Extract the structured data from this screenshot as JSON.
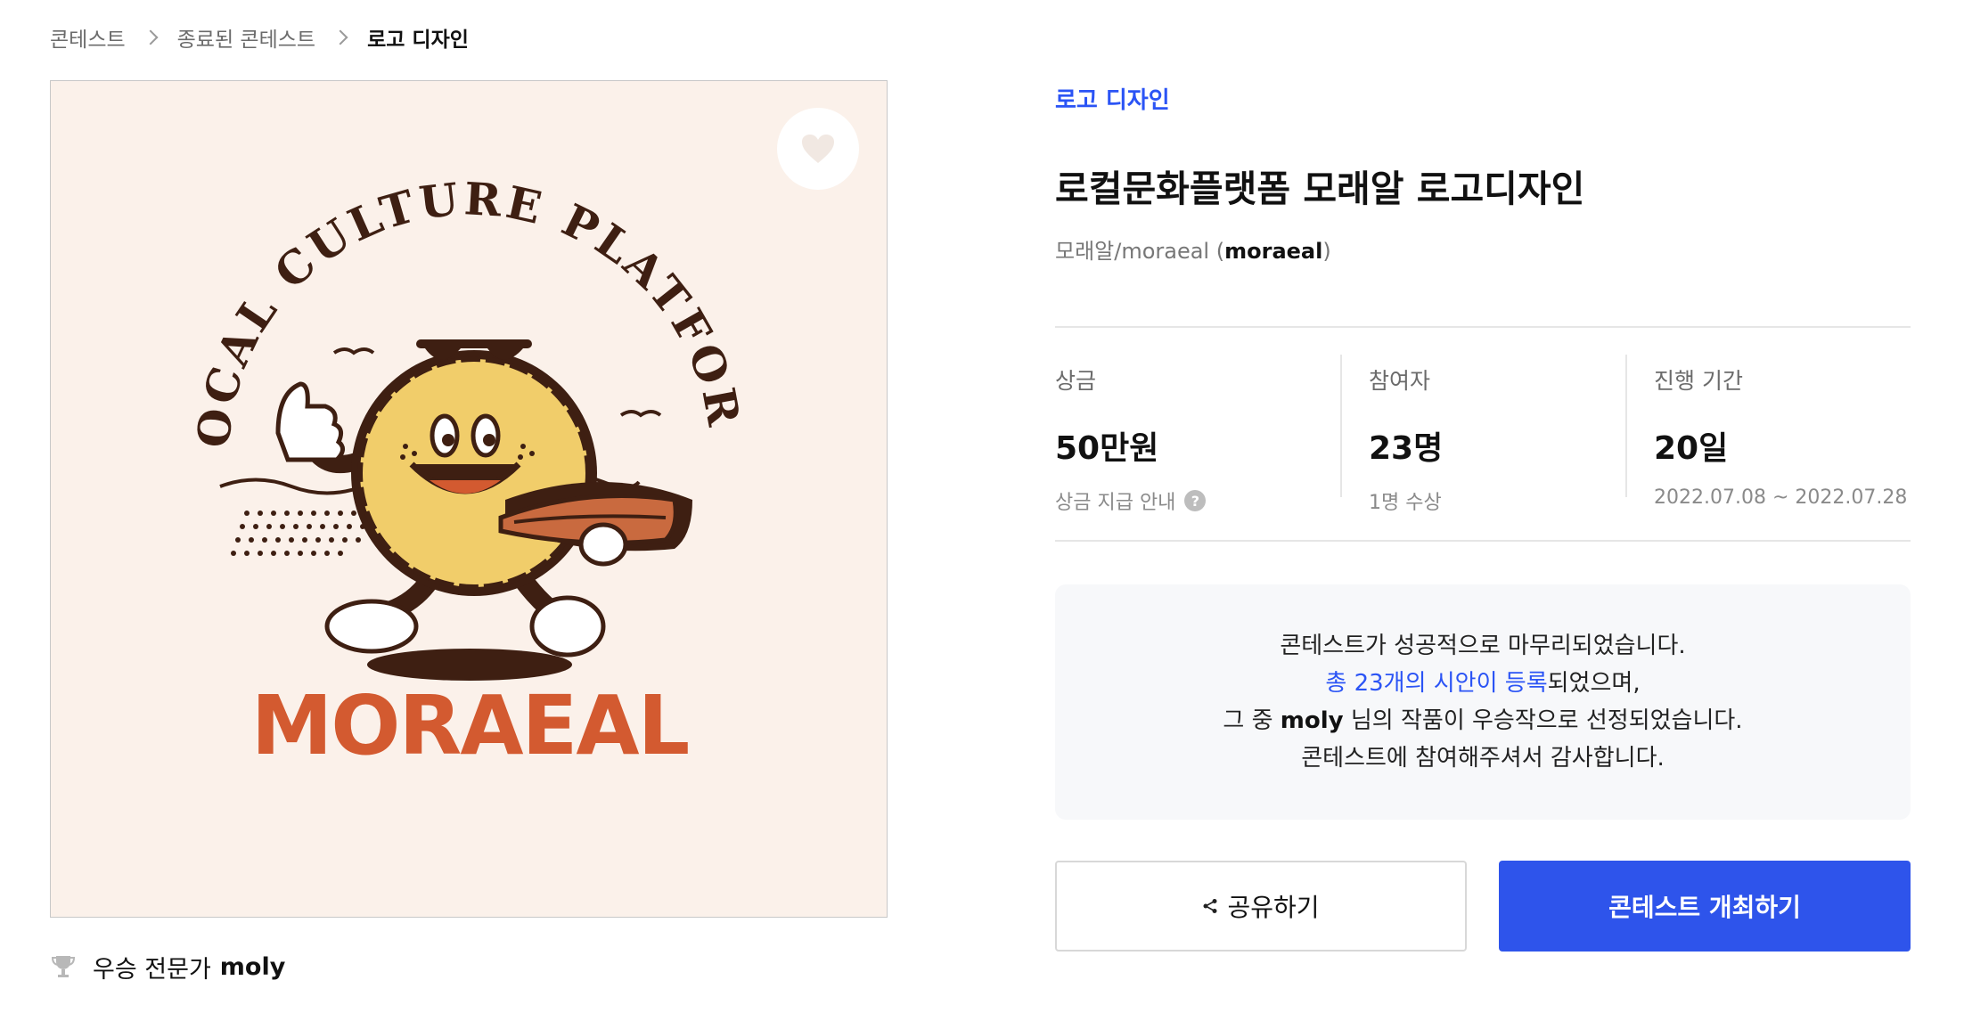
{
  "breadcrumb": {
    "items": [
      "콘테스트",
      "종료된 콘테스트",
      "로고 디자인"
    ]
  },
  "artwork": {
    "arc_text": "LOCAL CULTURE PLATFORM",
    "wordmark": "MORAEAL",
    "background_color": "#fbf1ea",
    "sun_color": "#f1cd6a",
    "brown_color": "#3e1f12",
    "accent_color": "#d35a30"
  },
  "winner": {
    "label": "우승 전문가",
    "name": "moly"
  },
  "contest": {
    "category": "로고 디자인",
    "title": "로컬문화플랫폼 모래알 로고디자인",
    "host_prefix": "모래알/moraeal (",
    "host_id": "moraeal",
    "host_suffix": ")"
  },
  "stats": [
    {
      "label": "상금",
      "value": "50만원",
      "sub": "상금 지급 안내",
      "help": "?"
    },
    {
      "label": "참여자",
      "value": "23명",
      "sub": "1명 수상"
    },
    {
      "label": "진행 기간",
      "value": "20일",
      "sub": "2022.07.08 ~ 2022.07.28"
    }
  ],
  "notice": {
    "line1": "콘테스트가 성공적으로 마무리되었습니다.",
    "line2_link": "총 23개의 시안이 등록",
    "line2_rest": "되었으며,",
    "line3_pre": "그 중 ",
    "line3_name": "moly",
    "line3_post": " 님의 작품이 우승작으로 선정되었습니다.",
    "line4": "콘테스트에 참여해주셔서 감사합니다."
  },
  "buttons": {
    "share": "공유하기",
    "host": "콘테스트 개최하기"
  },
  "colors": {
    "accent": "#2b54f5",
    "primary_button": "#2e54eb"
  }
}
